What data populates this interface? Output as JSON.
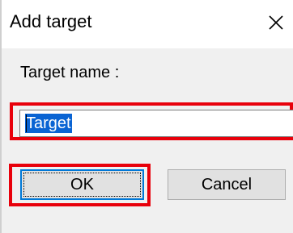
{
  "dialog": {
    "title": "Add target",
    "close_icon": "close-icon"
  },
  "form": {
    "label": "Target name :",
    "value": "Target"
  },
  "buttons": {
    "ok": "OK",
    "cancel": "Cancel"
  },
  "colors": {
    "highlight": "#e8000b",
    "selection": "#0a64d3",
    "focus_border": "#0078d7",
    "dialog_body": "#f0f0f0",
    "button_face": "#e1e1e1"
  }
}
